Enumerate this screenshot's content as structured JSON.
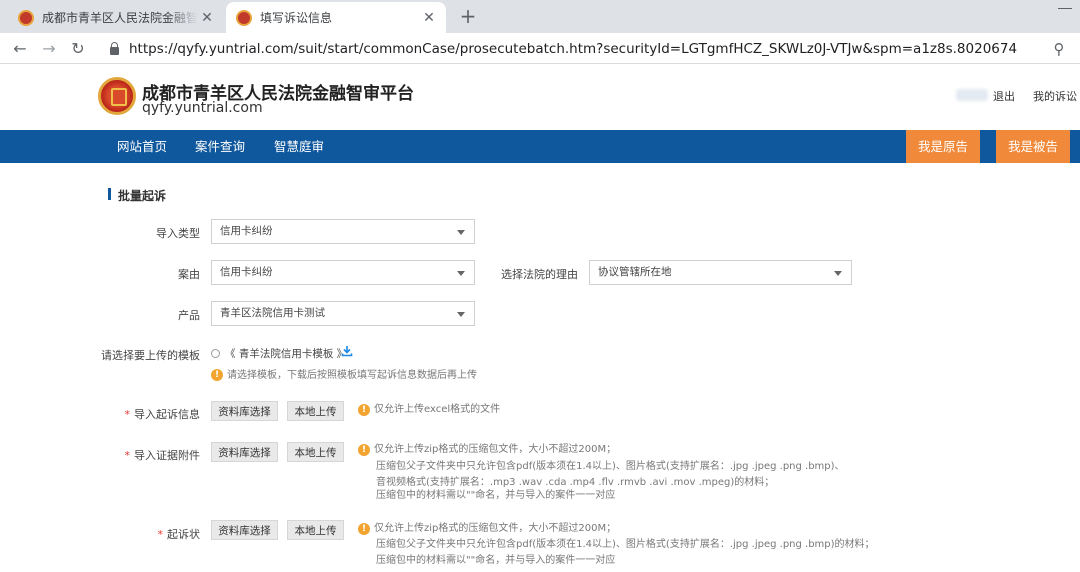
{
  "browser": {
    "tabs": [
      {
        "title": "成都市青羊区人民法院金融智审平",
        "active": false
      },
      {
        "title": "填写诉讼信息",
        "active": true
      }
    ],
    "url": "https://qyfy.yuntrial.com/suit/start/commonCase/prosecutebatch.htm?securityId=LGTgmfHCZ_SKWLz0J-VTJw&spm=a1z8s.8020674"
  },
  "header": {
    "title": "成都市青羊区人民法院金融智审平台",
    "domain": "qyfy.yuntrial.com",
    "logout": "退出",
    "my_suits": "我的诉讼"
  },
  "nav": {
    "items": [
      "网站首页",
      "案件查询",
      "智慧庭审"
    ],
    "plaintiff": "我是原告",
    "defendant": "我是被告"
  },
  "form": {
    "section_title": "批量起诉",
    "import_type": {
      "label": "导入类型",
      "value": "信用卡纠纷"
    },
    "case_cause": {
      "label": "案由",
      "value": "信用卡纠纷"
    },
    "court_reason": {
      "label": "选择法院的理由",
      "value": "协议管辖所在地"
    },
    "product": {
      "label": "产品",
      "value": "青羊区法院信用卡测试"
    },
    "template": {
      "label": "请选择要上传的模板",
      "name": "《 青羊法院信用卡模板 》",
      "hint": "请选择模板，下载后按照模板填写起诉信息数据后再上传"
    },
    "import_suit": {
      "label": "导入起诉信息",
      "btn_library": "资料库选择",
      "btn_local": "本地上传",
      "hint": "仅允许上传excel格式的文件"
    },
    "import_evidence": {
      "label": "导入证据附件",
      "btn_library": "资料库选择",
      "btn_local": "本地上传",
      "hint": [
        "仅允许上传zip格式的压缩包文件，大小不超过200M；",
        "压缩包父子文件夹中只允许包含pdf(版本须在1.4以上)、图片格式(支持扩展名：.jpg .jpeg .png .bmp)、",
        "音视频格式(支持扩展名：.mp3 .wav .cda .mp4 .flv .rmvb .avi .mov .mpeg)的材料；",
        "压缩包中的材料需以\"\"命名，并与导入的案件一一对应"
      ]
    },
    "complaint": {
      "label": "起诉状",
      "btn_library": "资料库选择",
      "btn_local": "本地上传",
      "hint": [
        "仅允许上传zip格式的压缩包文件，大小不超过200M；",
        "压缩包父子文件夹中只允许包含pdf(版本须在1.4以上)、图片格式(支持扩展名：.jpg .jpeg .png .bmp)的材料；",
        "压缩包中的材料需以\"\"命名，并与导入的案件一一对应"
      ]
    }
  },
  "colors": {
    "nav_bg": "#10589e",
    "role_button": "#f0893a",
    "required": "#e53935",
    "warning": "#f1a530"
  }
}
